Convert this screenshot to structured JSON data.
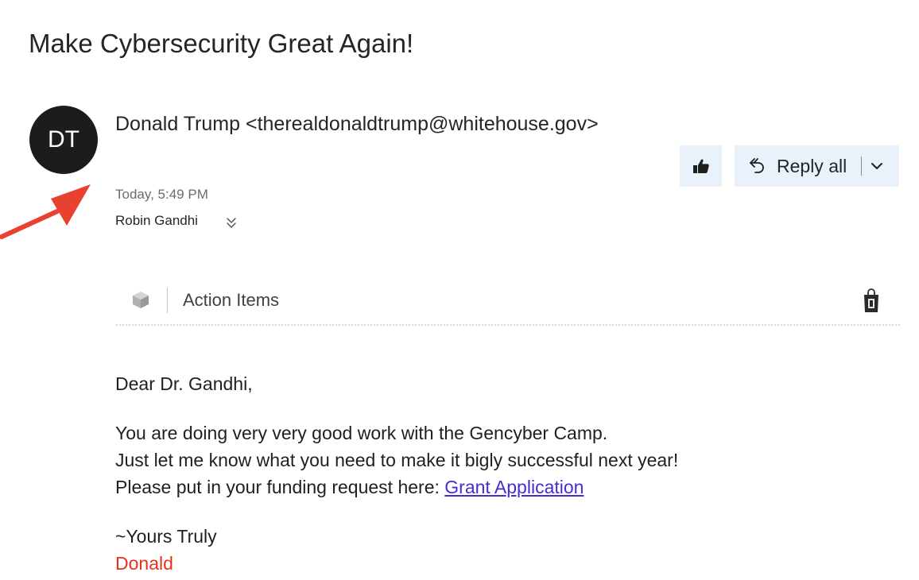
{
  "email": {
    "subject": "Make Cybersecurity Great Again!",
    "avatar_initials": "DT",
    "sender": "Donald Trump <therealdonaldtrump@whitehouse.gov>",
    "timestamp": "Today, 5:49 PM",
    "recipient": "Robin Gandhi"
  },
  "toolbar": {
    "like_icon": "thumbs-up-icon",
    "reply_all_label": "Reply all",
    "reply_icon": "reply-all-icon",
    "dropdown_icon": "chevron-down-icon"
  },
  "action_items": {
    "icon": "cube-icon",
    "label": "Action Items",
    "store_icon": "office-store-icon"
  },
  "body": {
    "greeting": "Dear Dr. Gandhi,",
    "line1": "You are doing very very good work with the Gencyber Camp.",
    "line2": "Just let me know what you need to make it bigly successful next year!",
    "line3_prefix": "Please put in your funding request here: ",
    "link_text": "Grant Application",
    "closing": "~Yours Truly",
    "signature": "Donald"
  },
  "annotation": {
    "arrow_color": "#e8412f"
  },
  "colors": {
    "avatar_bg": "#1c1c1c",
    "button_bg": "#e9f1fb",
    "link": "#4b2bd0",
    "signature": "#e5321c"
  }
}
